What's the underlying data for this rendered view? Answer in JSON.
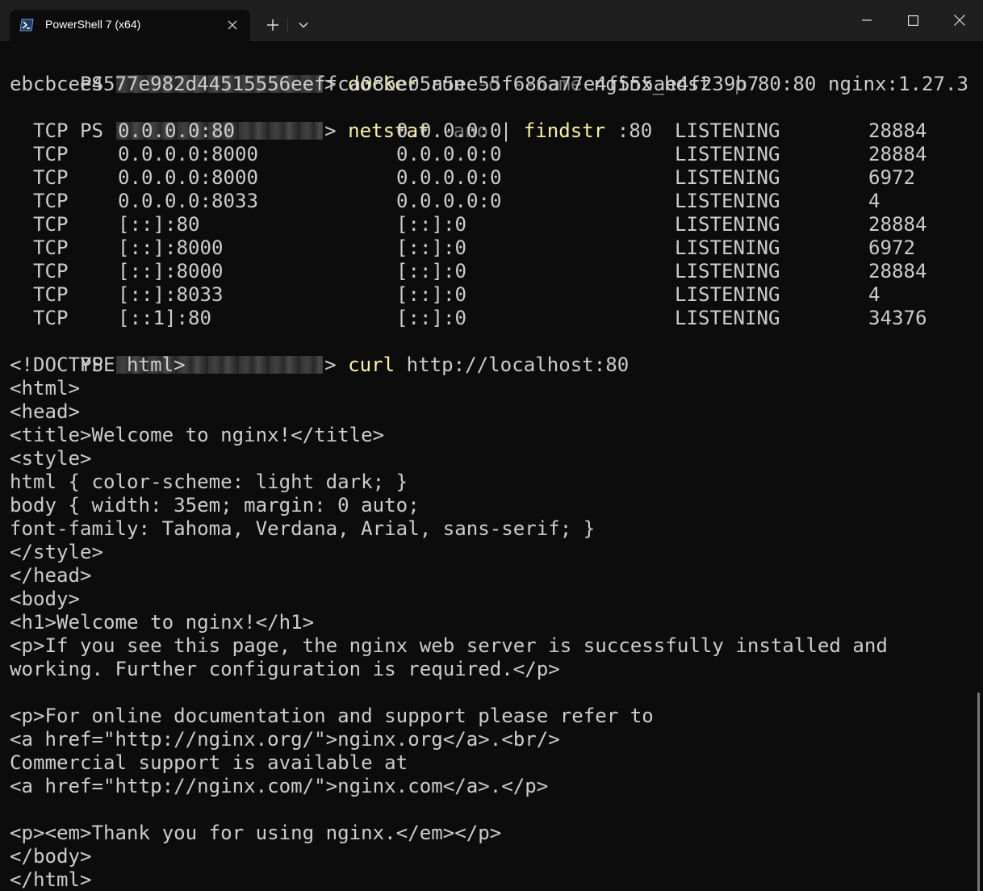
{
  "window": {
    "tab_title": "PowerShell 7 (x64)",
    "tab_icon": "powershell-icon",
    "controls": {
      "newtab_icon": "plus-icon",
      "dropdown_icon": "chevron-down-icon",
      "minimize_icon": "minimize-icon",
      "maximize_icon": "maximize-icon",
      "close_icon": "close-icon"
    }
  },
  "colors": {
    "background": "#0c0c0c",
    "titlebar": "#1f1f1f",
    "foreground": "#cccccc",
    "command": "#f9f1a5",
    "parameter": "#767676"
  },
  "terminal": {
    "prompt_prefix": "PS",
    "prompt_suffix": ">",
    "cmd1": {
      "command": "docker",
      "args": [
        {
          "text": "run",
          "kind": "arg"
        },
        {
          "text": "-d",
          "kind": "param"
        },
        {
          "text": "--name",
          "kind": "param"
        },
        {
          "text": "nginx_host",
          "kind": "arg"
        },
        {
          "text": "-p",
          "kind": "param"
        },
        {
          "text": "80:80",
          "kind": "arg"
        },
        {
          "text": "nginx:1.27.3",
          "kind": "arg"
        }
      ]
    },
    "container_id": "ebcbcee4577e982d44515556eeffca086e05a5ee55f686a77e4f555ae4f239b7",
    "cmd2": {
      "command": "netstat",
      "param": "-ano",
      "pipe": "|",
      "command2": "findstr",
      "arg": ":80"
    },
    "netstat_rows": [
      {
        "proto": "TCP",
        "local": "0.0.0.0:80",
        "foreign": "0.0.0.0:0",
        "state": "LISTENING",
        "pid": "28884"
      },
      {
        "proto": "TCP",
        "local": "0.0.0.0:8000",
        "foreign": "0.0.0.0:0",
        "state": "LISTENING",
        "pid": "28884"
      },
      {
        "proto": "TCP",
        "local": "0.0.0.0:8000",
        "foreign": "0.0.0.0:0",
        "state": "LISTENING",
        "pid": "6972"
      },
      {
        "proto": "TCP",
        "local": "0.0.0.0:8033",
        "foreign": "0.0.0.0:0",
        "state": "LISTENING",
        "pid": "4"
      },
      {
        "proto": "TCP",
        "local": "[::]:80",
        "foreign": "[::]:0",
        "state": "LISTENING",
        "pid": "28884"
      },
      {
        "proto": "TCP",
        "local": "[::]:8000",
        "foreign": "[::]:0",
        "state": "LISTENING",
        "pid": "6972"
      },
      {
        "proto": "TCP",
        "local": "[::]:8000",
        "foreign": "[::]:0",
        "state": "LISTENING",
        "pid": "28884"
      },
      {
        "proto": "TCP",
        "local": "[::]:8033",
        "foreign": "[::]:0",
        "state": "LISTENING",
        "pid": "4"
      },
      {
        "proto": "TCP",
        "local": "[::1]:80",
        "foreign": "[::]:0",
        "state": "LISTENING",
        "pid": "34376"
      }
    ],
    "cmd3": {
      "command": "curl",
      "arg": "http://localhost:80"
    },
    "curl_output": [
      "<!DOCTYPE html>",
      "<html>",
      "<head>",
      "<title>Welcome to nginx!</title>",
      "<style>",
      "html { color-scheme: light dark; }",
      "body { width: 35em; margin: 0 auto;",
      "font-family: Tahoma, Verdana, Arial, sans-serif; }",
      "</style>",
      "</head>",
      "<body>",
      "<h1>Welcome to nginx!</h1>",
      "<p>If you see this page, the nginx web server is successfully installed and",
      "working. Further configuration is required.</p>",
      "",
      "<p>For online documentation and support please refer to",
      "<a href=\"http://nginx.org/\">nginx.org</a>.<br/>",
      "Commercial support is available at",
      "<a href=\"http://nginx.com/\">nginx.com</a>.</p>",
      "",
      "<p><em>Thank you for using nginx.</em></p>",
      "</body>",
      "</html>"
    ]
  }
}
